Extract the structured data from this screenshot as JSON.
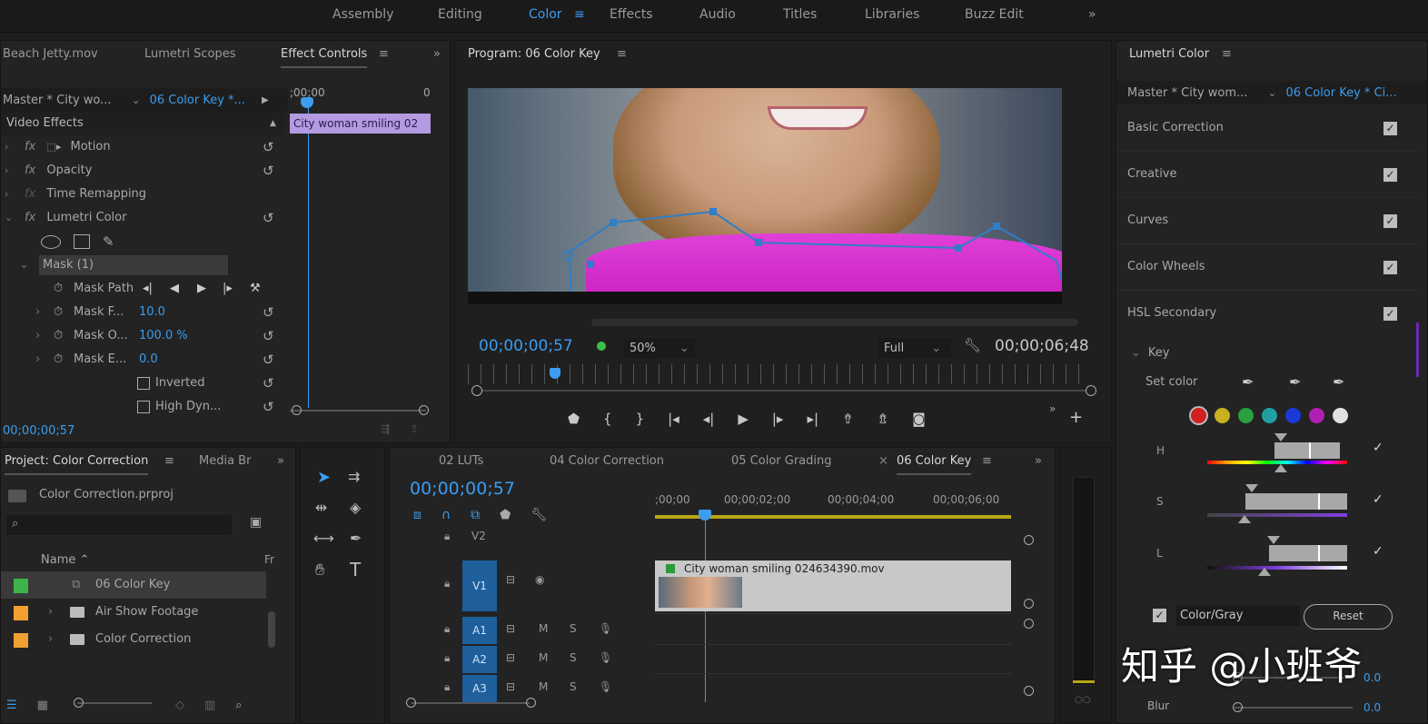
{
  "workspaces": {
    "items": [
      "Assembly",
      "Editing",
      "Color",
      "Effects",
      "Audio",
      "Titles",
      "Libraries",
      "Buzz Edit"
    ],
    "active": "Color",
    "overflow": "»"
  },
  "effect_controls": {
    "tabs": [
      "Beach Jetty.mov",
      "Lumetri Scopes",
      "Effect Controls"
    ],
    "master": "Master * City wo...",
    "clip": "06 Color Key *...",
    "timecode_start": ";00;00",
    "timecode_end": "0",
    "clip_bar": "City woman smiling 02",
    "section": "Video Effects",
    "effects": [
      {
        "name": "Motion",
        "fx": "fx"
      },
      {
        "name": "Opacity",
        "fx": "fx"
      },
      {
        "name": "Time Remapping",
        "fx": "fx"
      },
      {
        "name": "Lumetri Color",
        "fx": "fx"
      }
    ],
    "mask": "Mask (1)",
    "mask_path": "Mask Path",
    "params": [
      {
        "name": "Mask F...",
        "value": "10.0"
      },
      {
        "name": "Mask O...",
        "value": "100.0 %"
      },
      {
        "name": "Mask E...",
        "value": "0.0"
      }
    ],
    "inverted": "Inverted",
    "high_dyn": "High Dyn...",
    "current_time": "00;00;00;57"
  },
  "program": {
    "title": "Program: 06 Color Key",
    "timecode": "00;00;00;57",
    "zoom": "50%",
    "quality": "Full",
    "duration": "00;00;06;48"
  },
  "lumetri": {
    "title": "Lumetri Color",
    "master": "Master * City wom...",
    "clip": "06 Color Key * Ci...",
    "sections": [
      "Basic Correction",
      "Creative",
      "Curves",
      "Color Wheels",
      "HSL Secondary"
    ],
    "key": "Key",
    "set_color": "Set color",
    "swatches": [
      "#d02020",
      "#c8b020",
      "#2aa040",
      "#20a0a0",
      "#1a3ad8",
      "#b020b0",
      "#e0e0e0"
    ],
    "hsl_labels": [
      "H",
      "S",
      "L"
    ],
    "color_gray": "Color/Gray",
    "reset": "Reset",
    "denoise_value": "0.0",
    "blur": "Blur",
    "blur_value": "0.0"
  },
  "project": {
    "tabs": [
      "Project: Color Correction",
      "Media Br"
    ],
    "file": "Color Correction.prproj",
    "col_name": "Name",
    "col_fr": "Fr",
    "items": [
      {
        "name": "06 Color Key",
        "color": "#3cb44a",
        "type": "sequence"
      },
      {
        "name": "Air Show Footage",
        "color": "#f0a030",
        "type": "folder"
      },
      {
        "name": "Color Correction",
        "color": "#f0a030",
        "type": "folder"
      }
    ]
  },
  "timeline": {
    "tabs": [
      "02 LUTs",
      "04 Color Correction",
      "05 Color Grading",
      "06 Color Key"
    ],
    "timecode": "00;00;00;57",
    "ruler": [
      ";00;00",
      "00;00;02;00",
      "00;00;04;00",
      "00;00;06;00"
    ],
    "tracks": [
      "V2",
      "V1",
      "A1",
      "A2",
      "A3"
    ],
    "clip_name": "City woman smiling 024634390.mov"
  },
  "watermark": "知乎 @小班爷"
}
